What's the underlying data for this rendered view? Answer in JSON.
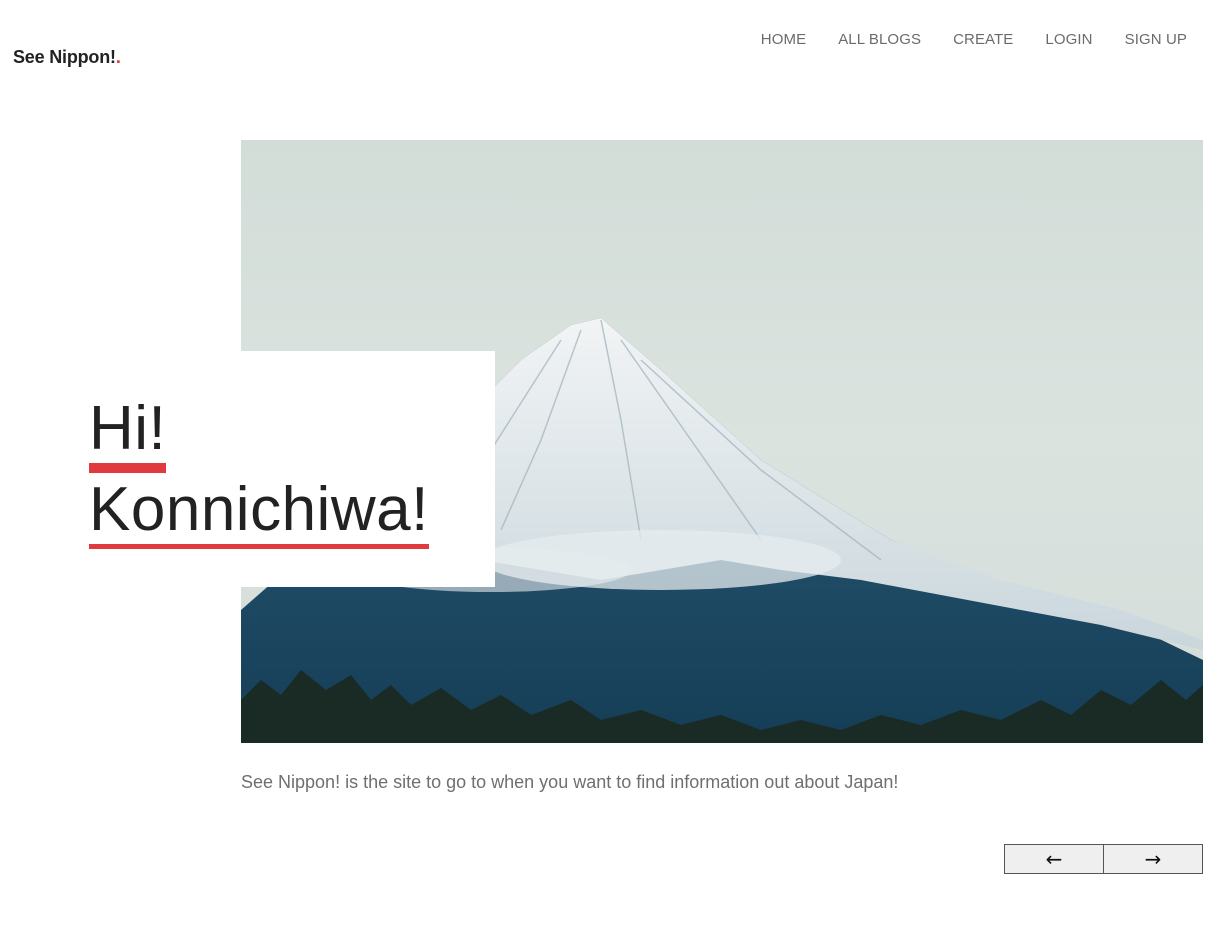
{
  "brand": {
    "name": "See Nippon!",
    "dot": "."
  },
  "nav": {
    "items": [
      {
        "label": "HOME"
      },
      {
        "label": "ALL BLOGS"
      },
      {
        "label": "CREATE"
      },
      {
        "label": "LOGIN"
      },
      {
        "label": "SIGN UP"
      }
    ]
  },
  "hero": {
    "line1": "Hi!",
    "line2": "Konnichiwa!",
    "image_subject": "Mount Fuji snow-capped peak"
  },
  "description": "See Nippon! is the site to go to when you want to find information out about Japan!",
  "slider": {
    "prev_label": "←",
    "next_label": "→"
  },
  "colors": {
    "accent": "#e03a3e"
  }
}
